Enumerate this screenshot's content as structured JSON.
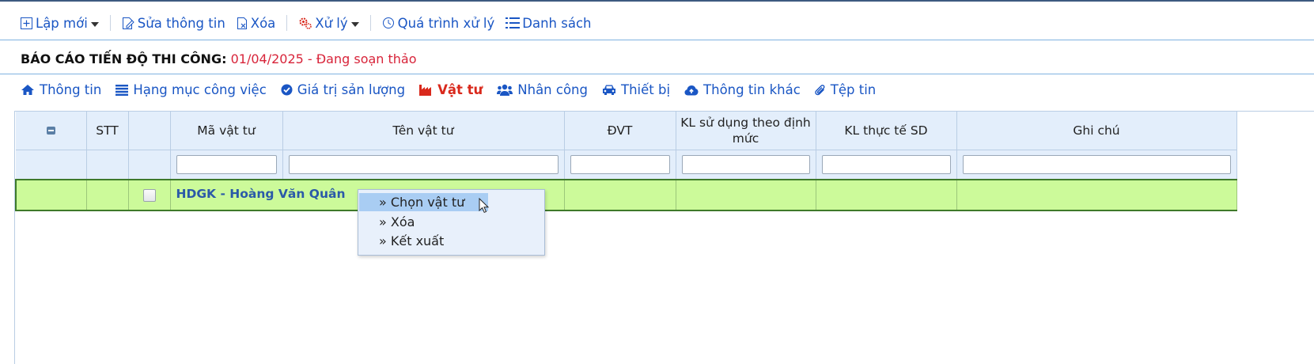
{
  "toolbar": {
    "new_label": "Lập mới",
    "edit_label": "Sửa thông tin",
    "delete_label": "Xóa",
    "process_label": "Xử lý",
    "history_label": "Quá trình xử lý",
    "list_label": "Danh sách"
  },
  "report": {
    "heading": "BÁO CÁO TIẾN ĐỘ THI CÔNG:",
    "date": "01/04/2025",
    "separator": "-",
    "status": "Đang soạn thảo"
  },
  "tabs": [
    {
      "label": "Thông tin",
      "icon": "home-icon"
    },
    {
      "label": "Hạng mục công việc",
      "icon": "list-icon"
    },
    {
      "label": "Giá trị sản lượng",
      "icon": "check-circle-icon"
    },
    {
      "label": "Vật tư",
      "icon": "industry-icon",
      "active": true
    },
    {
      "label": "Nhân công",
      "icon": "users-icon"
    },
    {
      "label": "Thiết bị",
      "icon": "car-icon"
    },
    {
      "label": "Thông tin khác",
      "icon": "cloud-upload-icon"
    },
    {
      "label": "Tệp tin",
      "icon": "paperclip-icon"
    }
  ],
  "grid": {
    "columns": [
      "",
      "STT",
      "",
      "Mã vật tư",
      "Tên vật tư",
      "ĐVT",
      "KL sử dụng theo định mức",
      "KL thực tế SD",
      "Ghi chú"
    ],
    "group_row": {
      "label": "HDGK - Hoàng Văn Quân"
    }
  },
  "context_menu": {
    "items": [
      "» Chọn vật tư",
      "» Xóa",
      "» Kết xuất"
    ]
  },
  "colors": {
    "link": "#1a56c4",
    "accent_red": "#d9291c",
    "status_red": "#d8243a",
    "row_highlight": "#ccfa9a",
    "header_bg": "#e3eefb",
    "menu_bg": "#e8f0fb",
    "menu_hover": "#a9cdf3"
  }
}
